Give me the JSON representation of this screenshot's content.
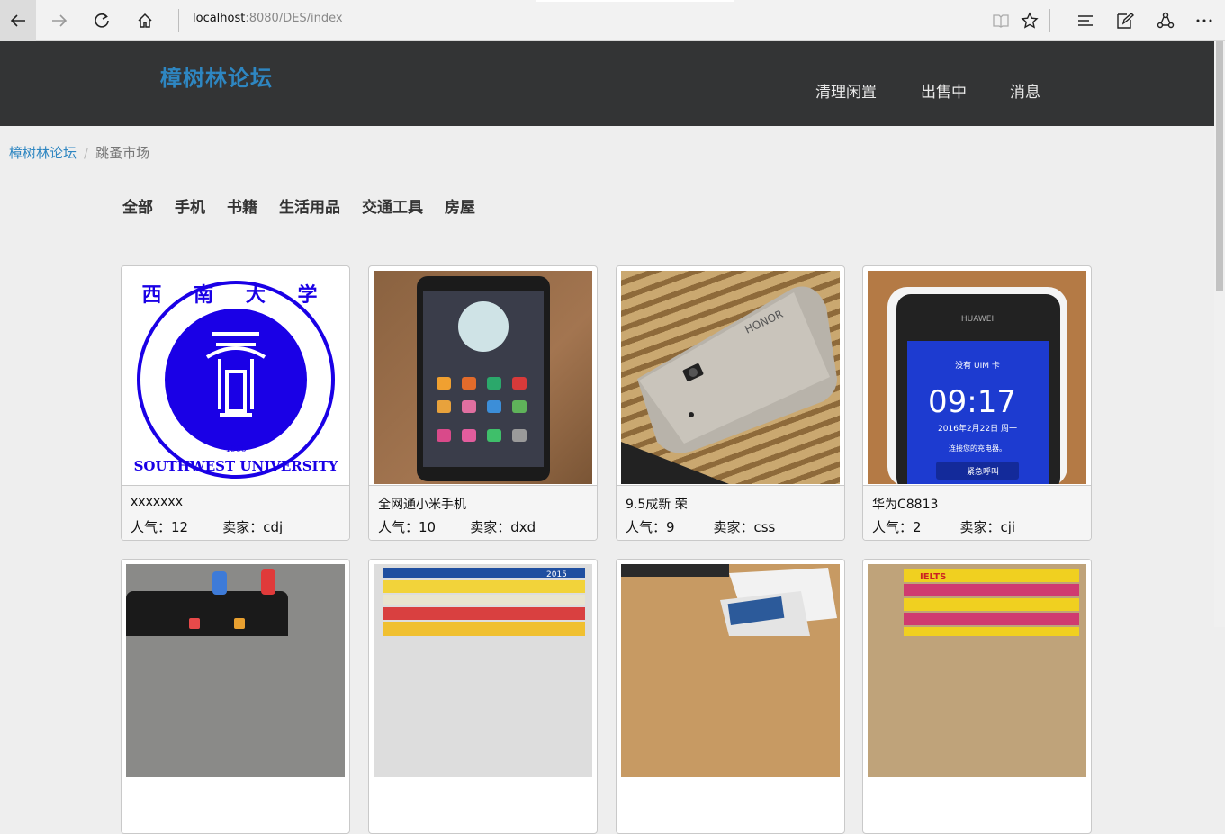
{
  "browser": {
    "url_host": "localhost",
    "url_path": ":8080/DES/index"
  },
  "site": {
    "brand": "樟树林论坛",
    "nav": [
      "清理闲置",
      "出售中",
      "消息"
    ]
  },
  "breadcrumb": {
    "home": "樟树林论坛",
    "current": "跳蚤市场"
  },
  "categories": [
    "全部",
    "手机",
    "书籍",
    "生活用品",
    "交通工具",
    "房屋"
  ],
  "items": [
    {
      "title": "xxxxxxx",
      "meta": "人气：12        卖家：cdj"
    },
    {
      "title": "全网通小米手机",
      "meta": "人气：10        卖家：dxd"
    },
    {
      "title": "9.5成新 荣",
      "meta": "人气：9         卖家：css"
    },
    {
      "title": "华为C8813",
      "meta": "人气：2         卖家：cji"
    }
  ],
  "images": {
    "logo_top_text": "西 南 大 学",
    "logo_ring_text": "SOUTHWEST UNIVERSITY",
    "logo_year": "1906",
    "phone_clock": "09:17",
    "phone_date": "2016年2月22日 周一",
    "phone_brand": "HUAWEI",
    "phone_signal": "没有 UIM 卡",
    "phone_hint": "连接您的充电器。",
    "phone_emergency": "紧急呼叫",
    "honor_logo": "HONOR",
    "book_year": "2015",
    "book_ielts": "IELTS"
  },
  "colors": {
    "brand": "#2e86c1",
    "header_bg": "#333435",
    "logo_blue": "#1a00e6"
  }
}
